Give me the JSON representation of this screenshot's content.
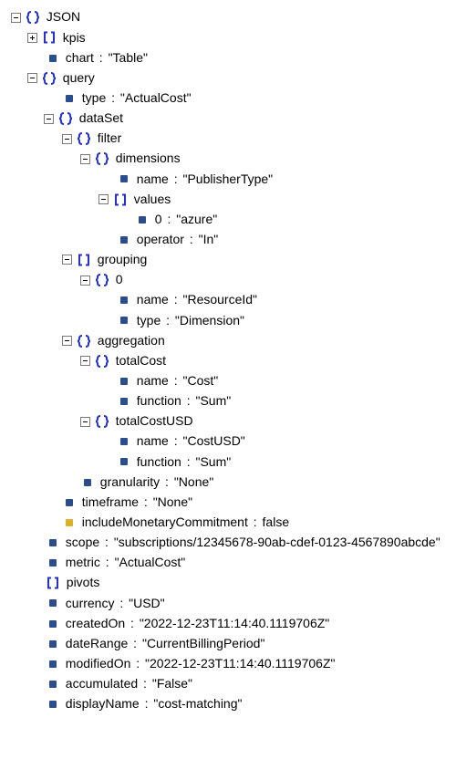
{
  "root": "JSON",
  "kpis": {
    "label": "kpis",
    "chart": {
      "key": "chart",
      "value": "\"Table\""
    }
  },
  "query": {
    "label": "query",
    "type": {
      "key": "type",
      "value": "\"ActualCost\""
    },
    "dataSet": {
      "label": "dataSet",
      "filter": {
        "label": "filter",
        "dimensions": {
          "label": "dimensions",
          "name": {
            "key": "name",
            "value": "\"PublisherType\""
          },
          "values": {
            "label": "values",
            "item0": {
              "key": "0",
              "value": "\"azure\""
            }
          },
          "operator": {
            "key": "operator",
            "value": "\"In\""
          }
        }
      },
      "grouping": {
        "label": "grouping",
        "item0": {
          "label": "0",
          "name": {
            "key": "name",
            "value": "\"ResourceId\""
          },
          "type": {
            "key": "type",
            "value": "\"Dimension\""
          }
        }
      },
      "aggregation": {
        "label": "aggregation",
        "totalCost": {
          "label": "totalCost",
          "name": {
            "key": "name",
            "value": "\"Cost\""
          },
          "function": {
            "key": "function",
            "value": "\"Sum\""
          }
        },
        "totalCostUSD": {
          "label": "totalCostUSD",
          "name": {
            "key": "name",
            "value": "\"CostUSD\""
          },
          "function": {
            "key": "function",
            "value": "\"Sum\""
          }
        }
      },
      "granularity": {
        "key": "granularity",
        "value": "\"None\""
      }
    },
    "timeframe": {
      "key": "timeframe",
      "value": "\"None\""
    },
    "includeMonetaryCommitment": {
      "key": "includeMonetaryCommitment",
      "value": "false"
    }
  },
  "scope": {
    "key": "scope",
    "value": "\"subscriptions/12345678-90ab-cdef-0123-4567890abcde\""
  },
  "metric": {
    "key": "metric",
    "value": "\"ActualCost\""
  },
  "pivots": {
    "label": "pivots"
  },
  "currency": {
    "key": "currency",
    "value": "\"USD\""
  },
  "createdOn": {
    "key": "createdOn",
    "value": "\"2022-12-23T11:14:40.1119706Z\""
  },
  "dateRange": {
    "key": "dateRange",
    "value": "\"CurrentBillingPeriod\""
  },
  "modifiedOn": {
    "key": "modifiedOn",
    "value": "\"2022-12-23T11:14:40.1119706Z\""
  },
  "accumulated": {
    "key": "accumulated",
    "value": "\"False\""
  },
  "displayName": {
    "key": "displayName",
    "value": "\"cost-matching\""
  }
}
